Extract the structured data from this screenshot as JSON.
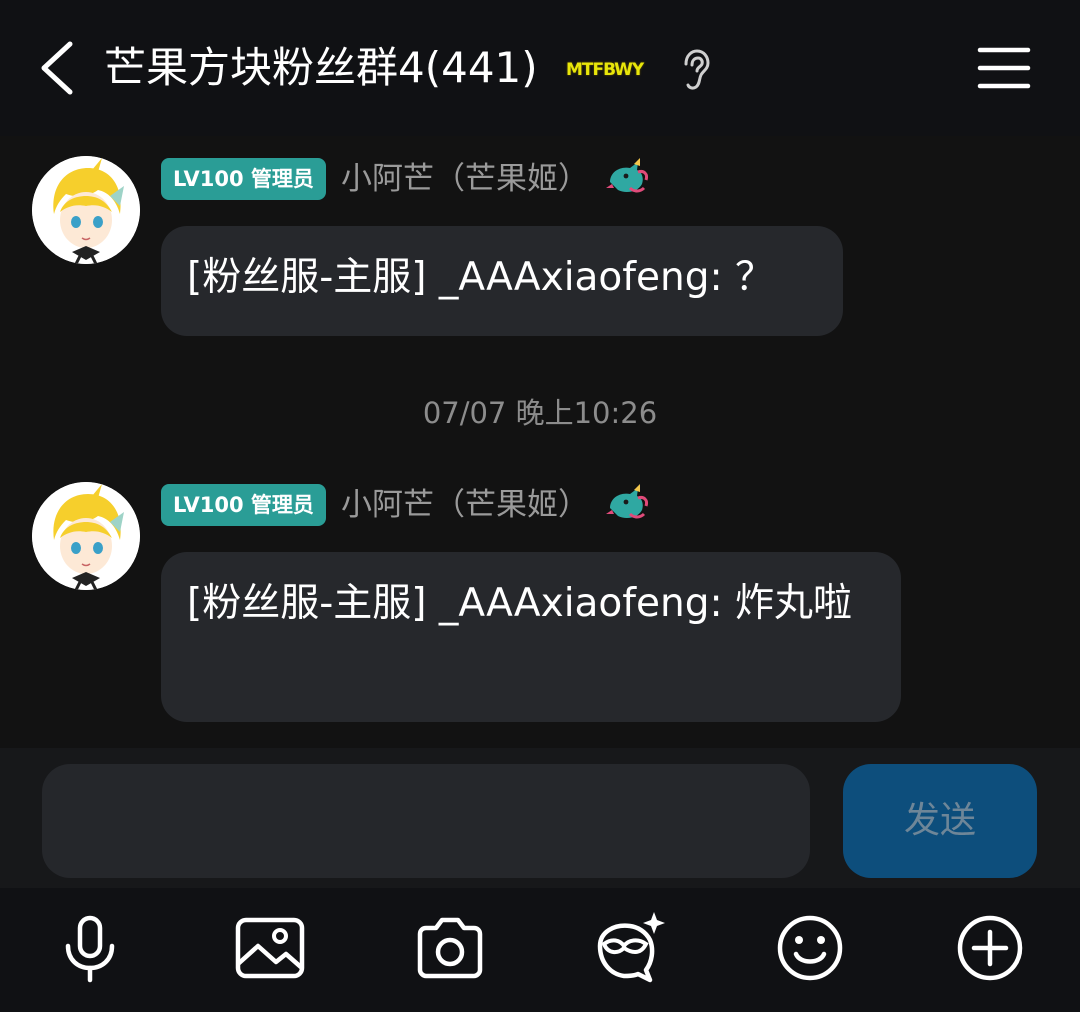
{
  "header": {
    "title": "芒果方块粉丝群4(441)",
    "brand_badge": "MTFBWY"
  },
  "messages": [
    {
      "level_badge": "LV100 管理员",
      "sender": "小阿芒（芒果姬）",
      "text": "[粉丝服-主服] _AAAxiaofeng: ？"
    },
    {
      "level_badge": "LV100 管理员",
      "sender": "小阿芒（芒果姬）",
      "text": "[粉丝服-主服] _AAAxiaofeng: 炸丸啦"
    }
  ],
  "timestamp": "07/07 晚上10:26",
  "composer": {
    "value": "",
    "send_label": "发送"
  },
  "toolbar": {
    "icons": [
      "microphone-icon",
      "image-icon",
      "camera-icon",
      "sticker-icon",
      "emoji-icon",
      "plus-icon"
    ]
  },
  "colors": {
    "badge": "#2a9d96",
    "bubble": "#26282c",
    "send_button": "#0d4e7c",
    "background": "#121212"
  }
}
